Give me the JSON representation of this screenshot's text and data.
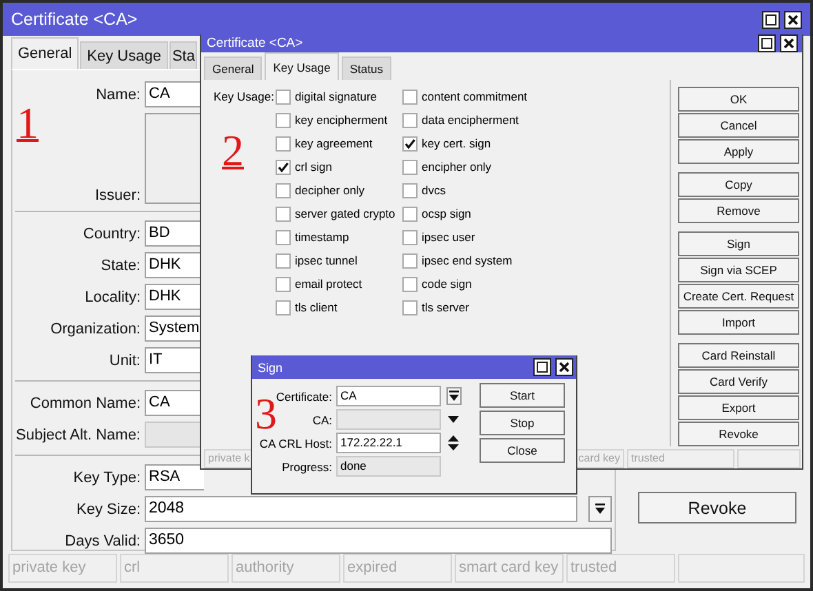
{
  "certificate_window": {
    "title": "Certificate <CA>",
    "tabs": [
      {
        "label": "General",
        "selected": true
      },
      {
        "label": "Key Usage",
        "selected": false
      },
      {
        "label": "Sta",
        "selected": false
      }
    ],
    "field_groups": [
      [
        {
          "label": "Name:",
          "value": "CA",
          "kind": "text",
          "disabled": false
        },
        {
          "label": "Issuer:",
          "kind": "box",
          "disabled": false
        }
      ],
      [
        {
          "label": "Country:",
          "value": "BD",
          "kind": "text",
          "disabled": false
        },
        {
          "label": "State:",
          "value": "DHK",
          "kind": "text",
          "disabled": false
        },
        {
          "label": "Locality:",
          "value": "DHK",
          "kind": "text",
          "disabled": false
        },
        {
          "label": "Organization:",
          "value": "System",
          "kind": "text",
          "disabled": false
        },
        {
          "label": "Unit:",
          "value": "IT",
          "kind": "text",
          "disabled": false
        }
      ],
      [
        {
          "label": "Common Name:",
          "value": "CA",
          "kind": "text",
          "disabled": false
        },
        {
          "label": "Subject Alt. Name:",
          "kind": "text",
          "disabled": true
        }
      ],
      [
        {
          "label": "Key Type:",
          "value": "RSA",
          "kind": "text",
          "disabled": false
        },
        {
          "label": "Key Size:",
          "value": "2048",
          "kind": "dropdown",
          "disabled": false
        },
        {
          "label": "Days Valid:",
          "value": "3650",
          "kind": "text",
          "disabled": false
        }
      ]
    ],
    "buttons": [
      "Revoke"
    ],
    "status_bar": [
      "private key",
      "crl",
      "authority",
      "expired",
      "smart card key",
      "trusted"
    ]
  },
  "key_usage_window": {
    "title": "Certificate <CA>",
    "tabs": [
      {
        "label": "General",
        "selected": false
      },
      {
        "label": "Key Usage",
        "selected": true
      },
      {
        "label": "Status",
        "selected": false
      }
    ],
    "group_label": "Key Usage:",
    "option_columns": [
      [
        {
          "label": "digital signature",
          "checked": false
        },
        {
          "label": "key encipherment",
          "checked": false
        },
        {
          "label": "key agreement",
          "checked": false
        },
        {
          "label": "crl sign",
          "checked": true
        },
        {
          "label": "decipher only",
          "checked": false
        },
        {
          "label": "server gated crypto",
          "checked": false
        },
        {
          "label": "timestamp",
          "checked": false
        },
        {
          "label": "ipsec tunnel",
          "checked": false
        },
        {
          "label": "email protect",
          "checked": false
        },
        {
          "label": "tls client",
          "checked": false
        }
      ],
      [
        {
          "label": "content commitment",
          "checked": false
        },
        {
          "label": "data encipherment",
          "checked": false
        },
        {
          "label": "key cert. sign",
          "checked": true
        },
        {
          "label": "encipher only",
          "checked": false
        },
        {
          "label": "dvcs",
          "checked": false
        },
        {
          "label": "ocsp sign",
          "checked": false
        },
        {
          "label": "ipsec user",
          "checked": false
        },
        {
          "label": "ipsec end system",
          "checked": false
        },
        {
          "label": "code sign",
          "checked": false
        },
        {
          "label": "tls server",
          "checked": false
        }
      ]
    ],
    "button_groups": [
      [
        "OK",
        "Cancel",
        "Apply"
      ],
      [
        "Copy",
        "Remove"
      ],
      [
        "Sign",
        "Sign via SCEP",
        "Create Cert. Request",
        "Import"
      ],
      [
        "Card Reinstall",
        "Card Verify",
        "Export",
        "Revoke"
      ]
    ],
    "status_bar": [
      "private k",
      "card key",
      "trusted"
    ]
  },
  "sign_dialog": {
    "title": "Sign",
    "fields": [
      {
        "label": "Certificate:",
        "value": "CA",
        "kind": "dropdown_box",
        "disabled": false
      },
      {
        "label": "CA:",
        "kind": "dropdown",
        "disabled": true
      },
      {
        "label": "CA CRL Host:",
        "value": "172.22.22.1",
        "kind": "spinner",
        "disabled": false
      },
      {
        "label": "Progress:",
        "value": "done",
        "kind": "text",
        "disabled": true
      }
    ],
    "buttons": [
      "Start",
      "Stop",
      "Close"
    ]
  },
  "annotations": [
    "1",
    "2",
    "3"
  ]
}
